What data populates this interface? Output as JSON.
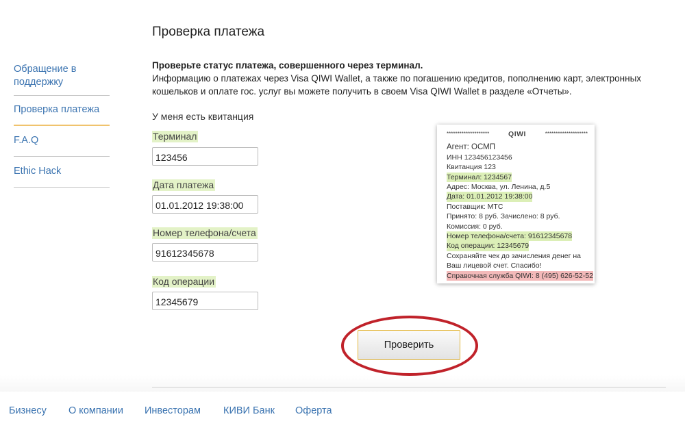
{
  "page": {
    "title": "Проверка платежа"
  },
  "sidebar": {
    "items": [
      {
        "label": "Обращение в поддержку"
      },
      {
        "label": "Проверка платежа"
      },
      {
        "label": "F.A.Q"
      },
      {
        "label": "Ethic Hack"
      }
    ]
  },
  "intro": {
    "bold": "Проверьте статус платежа, совершенного через терминал.",
    "text": "Информацию о платежах через Visa QIWI Wallet, а также по погашению кредитов, пополнению карт, электронных кошельков и оплате гос. услуг вы можете получить в своем Visa QIWI Wallet в разделе «Отчеты»."
  },
  "form": {
    "receipt_label": "У меня есть квитанция",
    "terminal": {
      "label": "Терминал",
      "value": "123456"
    },
    "date": {
      "label": "Дата платежа",
      "value": "01.01.2012 19:38:00"
    },
    "phone": {
      "label": "Номер телефона/счета",
      "value": "91612345678"
    },
    "code": {
      "label": "Код операции",
      "value": "12345679"
    },
    "submit_label": "Проверить"
  },
  "receipt": {
    "stars_left": "********************",
    "brand": "QIWI",
    "stars_right": "********************",
    "lines": [
      "Агент: ОСМП",
      "ИНН 123456123456",
      "Квитанция 123",
      "Терминал: 1234567",
      "Адрес: Москва, ул. Ленина, д.5",
      "Дата: 01.01.2012 19:38:00",
      "Поставщик: МТС",
      "Принято: 8 руб.  Зачислено: 8 руб.",
      "Комиссия: 0 руб.",
      "Номер телефона/счета: 91612345678",
      "Код операции: 12345679",
      "Сохраняйте чек до зачисления денег на",
      "Ваш лицевой счет. Спасибо!",
      "Справочная служба QIWI: 8 (495) 626-52-52"
    ]
  },
  "footer": {
    "links": [
      {
        "label": "Бизнесу"
      },
      {
        "label": "О компании"
      },
      {
        "label": "Инвесторам"
      },
      {
        "label": "КИВИ Банк"
      },
      {
        "label": "Оферта"
      }
    ]
  },
  "colors": {
    "link": "#3a73b0",
    "highlight_green": "#e3f2c7",
    "highlight_red": "#f3b9b9",
    "circle": "#c0222a",
    "button_border": "#e3b73b"
  }
}
